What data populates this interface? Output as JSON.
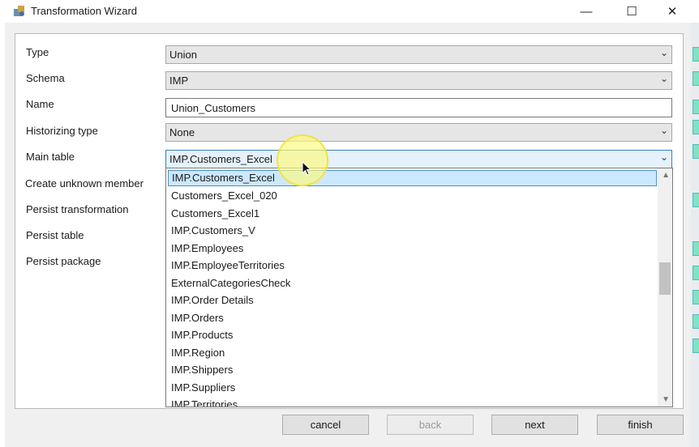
{
  "window": {
    "title": "Transformation Wizard",
    "minimize": "—",
    "maximize": "☐",
    "close": "✕"
  },
  "form": {
    "type": {
      "label": "Type",
      "value": "Union"
    },
    "schema": {
      "label": "Schema",
      "value": "IMP"
    },
    "name": {
      "label": "Name",
      "value": "Union_Customers"
    },
    "historizing": {
      "label": "Historizing type",
      "value": "None"
    },
    "main_table": {
      "label": "Main table",
      "value": "IMP.Customers_Excel"
    },
    "create_unknown": {
      "label": "Create unknown member"
    },
    "persist_transformation": {
      "label": "Persist transformation"
    },
    "persist_table": {
      "label": "Persist table"
    },
    "persist_package": {
      "label": "Persist package"
    }
  },
  "dropdown": {
    "options": [
      "IMP.Customers_Excel",
      "Customers_Excel_020",
      "Customers_Excel1",
      "IMP.Customers_V",
      "IMP.Employees",
      "IMP.EmployeeTerritories",
      "ExternalCategoriesCheck",
      "IMP.Order Details",
      "IMP.Orders",
      "IMP.Products",
      "IMP.Region",
      "IMP.Shippers",
      "IMP.Suppliers",
      "IMP.Territories"
    ],
    "selected_index": 0
  },
  "buttons": {
    "cancel": "cancel",
    "back": "back",
    "next": "next",
    "finish": "finish"
  },
  "icons": {
    "dropdown_arrow": "chevron-down-icon",
    "app": "wizard-app-icon",
    "cursor": "mouse-pointer-icon"
  }
}
